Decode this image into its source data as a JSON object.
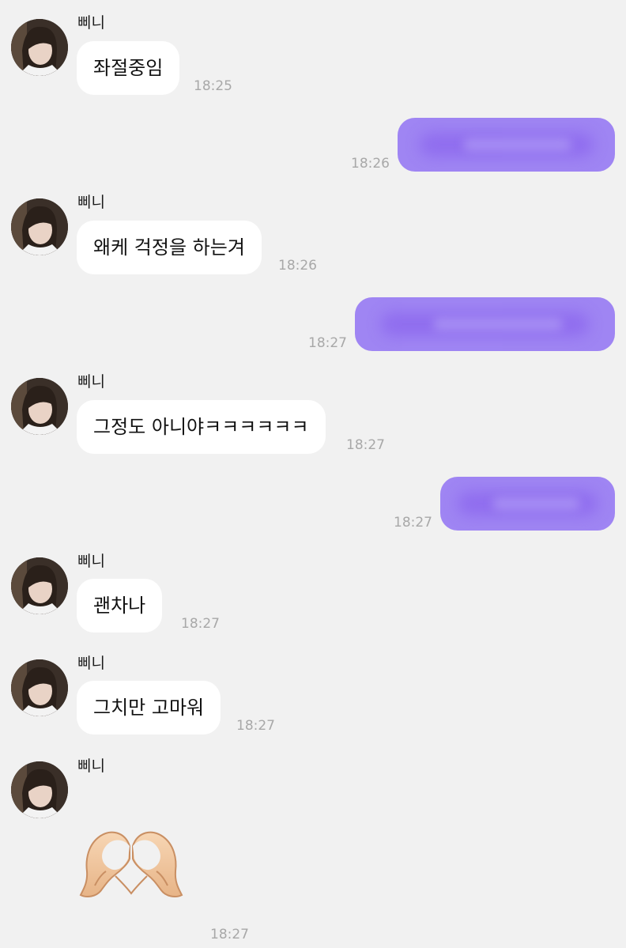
{
  "sender_name": "삐니",
  "messages": [
    {
      "type": "received",
      "text": "좌절중임",
      "time": "18:25"
    },
    {
      "type": "sent",
      "content": "blurred",
      "time": "18:26"
    },
    {
      "type": "received",
      "text": "왜케 걱정을 하는겨",
      "time": "18:26"
    },
    {
      "type": "sent",
      "content": "blurred",
      "time": "18:27"
    },
    {
      "type": "received",
      "text": "그정도 아니야ㅋㅋㅋㅋㅋㅋ",
      "time": "18:27"
    },
    {
      "type": "sent",
      "content": "blurred",
      "time": "18:27"
    },
    {
      "type": "received",
      "text": "괜차나",
      "time": "18:27"
    },
    {
      "type": "received",
      "text": "그치만 고마워",
      "time": "18:27"
    },
    {
      "type": "received_emoji",
      "emoji": "heart-hands-icon",
      "time": "18:27"
    }
  ],
  "colors": {
    "background": "#f1f1f1",
    "received_bubble": "#ffffff",
    "sent_bubble": "#9f85f3",
    "timestamp": "#a8a8a8"
  }
}
